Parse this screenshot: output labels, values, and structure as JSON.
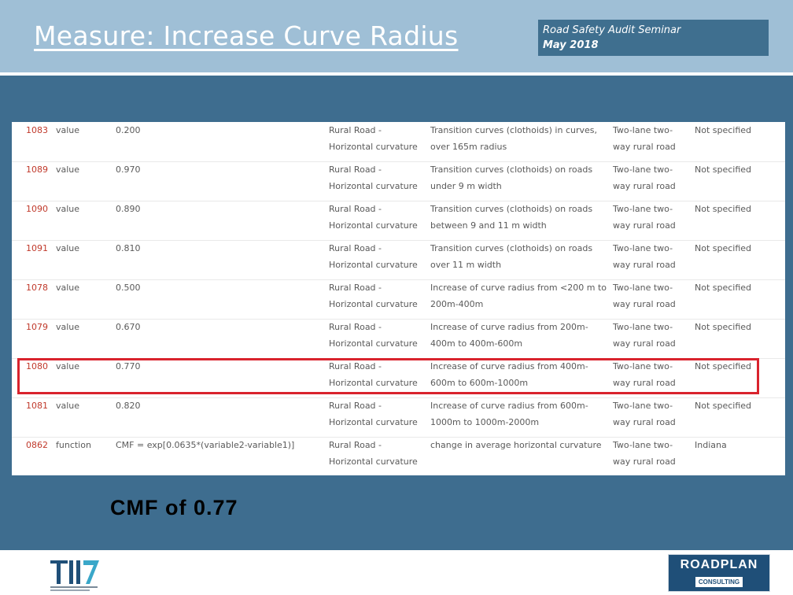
{
  "title": "Measure: Increase Curve Radius",
  "seminar": {
    "line1": "Road Safety Audit Seminar",
    "line2": "May 2018"
  },
  "rows": [
    {
      "id": "1083",
      "type": "value",
      "val": "0.200",
      "cat1": "Rural Road -",
      "cat2": "Horizontal curvature",
      "desc1": "Transition curves (clothoids) in curves,",
      "desc2": "over 165m radius",
      "road1": "Two-lane two-",
      "road2": "way rural road",
      "loc": "Not specified"
    },
    {
      "id": "1089",
      "type": "value",
      "val": "0.970",
      "cat1": "Rural Road -",
      "cat2": "Horizontal curvature",
      "desc1": "Transition curves (clothoids) on roads",
      "desc2": "under 9 m width",
      "road1": "Two-lane two-",
      "road2": "way rural road",
      "loc": "Not specified"
    },
    {
      "id": "1090",
      "type": "value",
      "val": "0.890",
      "cat1": "Rural Road -",
      "cat2": "Horizontal curvature",
      "desc1": "Transition curves (clothoids) on roads",
      "desc2": "between 9 and 11 m width",
      "road1": "Two-lane two-",
      "road2": "way rural road",
      "loc": "Not specified"
    },
    {
      "id": "1091",
      "type": "value",
      "val": "0.810",
      "cat1": "Rural Road -",
      "cat2": "Horizontal curvature",
      "desc1": "Transition curves (clothoids) on roads",
      "desc2": "over 11 m width",
      "road1": "Two-lane two-",
      "road2": "way rural road",
      "loc": "Not specified"
    },
    {
      "id": "1078",
      "type": "value",
      "val": "0.500",
      "cat1": "Rural Road -",
      "cat2": "Horizontal curvature",
      "desc1": "Increase of curve radius from <200 m to",
      "desc2": "200m-400m",
      "road1": "Two-lane two-",
      "road2": "way rural road",
      "loc": "Not specified"
    },
    {
      "id": "1079",
      "type": "value",
      "val": "0.670",
      "cat1": "Rural Road -",
      "cat2": "Horizontal curvature",
      "desc1": "Increase of curve radius from 200m-",
      "desc2": "400m to 400m-600m",
      "road1": "Two-lane two-",
      "road2": "way rural road",
      "loc": "Not specified"
    },
    {
      "id": "1080",
      "type": "value",
      "val": "0.770",
      "cat1": "Rural Road -",
      "cat2": "Horizontal curvature",
      "desc1": "Increase of curve radius from 400m-",
      "desc2": "600m to 600m-1000m",
      "road1": "Two-lane two-",
      "road2": "way rural road",
      "loc": "Not specified"
    },
    {
      "id": "1081",
      "type": "value",
      "val": "0.820",
      "cat1": "Rural Road -",
      "cat2": "Horizontal curvature",
      "desc1": "Increase of curve radius from 600m-",
      "desc2": "1000m to 1000m-2000m",
      "road1": "Two-lane two-",
      "road2": "way rural road",
      "loc": "Not specified"
    },
    {
      "id": "0862",
      "type": "function",
      "val": "CMF = exp[0.0635*(variable2-variable1)]",
      "cat1": "Rural Road -",
      "cat2": "Horizontal curvature",
      "desc1": "change in average horizontal curvature",
      "desc2": "",
      "road1": "Two-lane two-",
      "road2": "way rural road",
      "loc": "Indiana"
    }
  ],
  "cmf_label": "CMF of 0.77",
  "logos": {
    "roadplan_top": "ROADPLAN",
    "roadplan_bottom": "CONSULTING"
  },
  "colors": {
    "header_band": "#9fbfd6",
    "main_band": "#3e6d8f",
    "highlight": "#d9232d",
    "id_text": "#c0392b"
  }
}
